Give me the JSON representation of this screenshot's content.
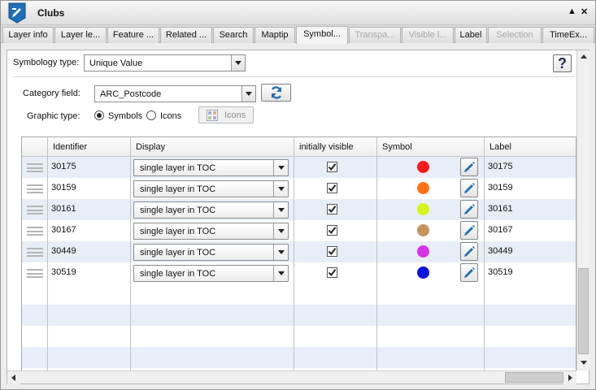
{
  "window": {
    "title": "Clubs",
    "minimize": "▲",
    "close": "✕"
  },
  "tabs": [
    {
      "label": "Layer info",
      "state": "normal"
    },
    {
      "label": "Layer le...",
      "state": "normal"
    },
    {
      "label": "Feature ...",
      "state": "normal"
    },
    {
      "label": "Related ...",
      "state": "normal"
    },
    {
      "label": "Search",
      "state": "normal"
    },
    {
      "label": "Maptip",
      "state": "normal"
    },
    {
      "label": "Symbol...",
      "state": "active"
    },
    {
      "label": "Transpa...",
      "state": "disabled"
    },
    {
      "label": "Visible l...",
      "state": "disabled"
    },
    {
      "label": "Label",
      "state": "normal"
    },
    {
      "label": "Selection",
      "state": "disabled"
    },
    {
      "label": "TimeEx...",
      "state": "normal"
    }
  ],
  "symbology": {
    "label": "Symbology type:",
    "value": "Unique Value"
  },
  "help_label": "?",
  "category": {
    "label": "Category field:",
    "value": "ARC_Postcode"
  },
  "graphic": {
    "label": "Graphic type:",
    "symbols_label": "Symbols",
    "icons_label": "Icons",
    "selected": "Symbols",
    "icons_button": "Icons"
  },
  "grid": {
    "headers": [
      "Identifier",
      "Display",
      "initially visible",
      "Symbol",
      "Label"
    ],
    "rows": [
      {
        "identifier": "30175",
        "display": "single layer in TOC",
        "visible": true,
        "color": "#ff1a1a",
        "label": "30175"
      },
      {
        "identifier": "30159",
        "display": "single layer in TOC",
        "visible": true,
        "color": "#ff7214",
        "label": "30159"
      },
      {
        "identifier": "30161",
        "display": "single layer in TOC",
        "visible": true,
        "color": "#d6f51a",
        "label": "30161"
      },
      {
        "identifier": "30167",
        "display": "single layer in TOC",
        "visible": true,
        "color": "#c9915e",
        "label": "30167"
      },
      {
        "identifier": "30449",
        "display": "single layer in TOC",
        "visible": true,
        "color": "#d633e8",
        "label": "30449"
      },
      {
        "identifier": "30519",
        "display": "single layer in TOC",
        "visible": true,
        "color": "#0a14e0",
        "label": "30519"
      }
    ]
  },
  "colors": {
    "accent": "#1f6fb8",
    "row_alt": "#e8eef7"
  }
}
